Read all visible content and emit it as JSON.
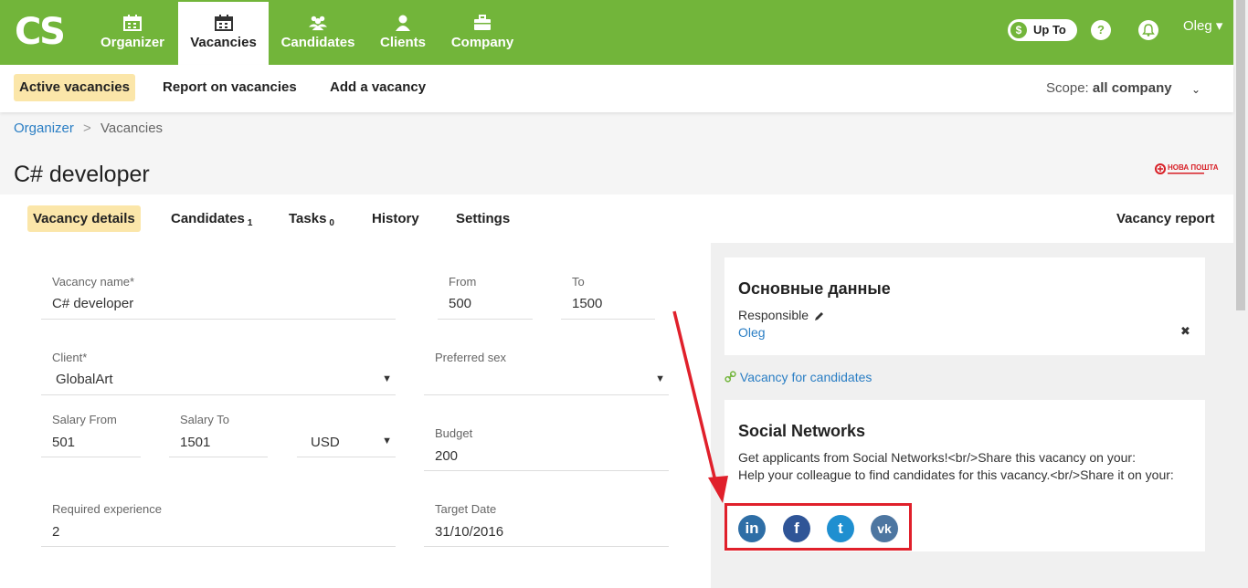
{
  "logo": "CS",
  "nav": {
    "items": [
      {
        "label": "Organizer",
        "icon": "calendar-icon"
      },
      {
        "label": "Vacancies",
        "icon": "calendar-icon"
      },
      {
        "label": "Candidates",
        "icon": "users-icon"
      },
      {
        "label": "Clients",
        "icon": "user-icon"
      },
      {
        "label": "Company",
        "icon": "briefcase-icon"
      }
    ],
    "upto_symbol": "$",
    "upto_label": "Up To",
    "help_symbol": "?",
    "user_name": "Oleg ▾"
  },
  "subnav": {
    "items": [
      "Active vacancies",
      "Report on vacancies",
      "Add a vacancy"
    ],
    "scope_label": "Scope:",
    "scope_value": "all company",
    "scope_caret": "⌄"
  },
  "breadcrumb": {
    "parent": "Organizer",
    "separator": ">",
    "current": "Vacancies"
  },
  "page_title": "C# developer",
  "client_logo_text": "НОВА ПОШТА",
  "tabs": [
    {
      "label": "Vacancy details",
      "count": ""
    },
    {
      "label": "Candidates",
      "count": "1"
    },
    {
      "label": "Tasks",
      "count": "0"
    },
    {
      "label": "History",
      "count": ""
    },
    {
      "label": "Settings",
      "count": ""
    }
  ],
  "vacancy_report": "Vacancy report",
  "form": {
    "vacancy_name": {
      "label": "Vacancy name*",
      "value": "C# developer"
    },
    "from": {
      "label": "From",
      "value": "500"
    },
    "to": {
      "label": "To",
      "value": "1500"
    },
    "client": {
      "label": "Client*",
      "value": "GlobalArt"
    },
    "preferred_sex": {
      "label": "Preferred sex",
      "value": ""
    },
    "salary_from": {
      "label": "Salary From",
      "value": "501"
    },
    "salary_to": {
      "label": "Salary To",
      "value": "1501"
    },
    "currency": {
      "value": "USD"
    },
    "budget": {
      "label": "Budget",
      "value": "200"
    },
    "required_experience": {
      "label": "Required experience",
      "value": "2"
    },
    "target_date": {
      "label": "Target Date",
      "value": "31/10/2016"
    },
    "caret": "▼"
  },
  "main_info": {
    "title": "Основные данные",
    "responsible_label": "Responsible",
    "responsible_name": "Oleg",
    "remove_symbol": "✖"
  },
  "vacancy_link": "Vacancy for candidates",
  "social": {
    "title": "Social Networks",
    "text1": "Get applicants from Social Networks!<br/>Share this vacancy on your:",
    "text2": "Help your colleague to find candidates for this vacancy.<br/>Share it on your:",
    "networks": [
      {
        "name": "linkedin",
        "glyph": "in",
        "color": "#2e6ea6"
      },
      {
        "name": "facebook",
        "glyph": "f",
        "color": "#2f5597"
      },
      {
        "name": "twitter",
        "glyph": "t",
        "color": "#1f8fd0"
      },
      {
        "name": "vk",
        "glyph": "vk",
        "color": "#4d76a1"
      }
    ]
  },
  "colors": {
    "brand_green": "#72b53a",
    "highlight": "#fbe6a9",
    "link": "#2a7ec4",
    "annotation_red": "#e0202b"
  }
}
